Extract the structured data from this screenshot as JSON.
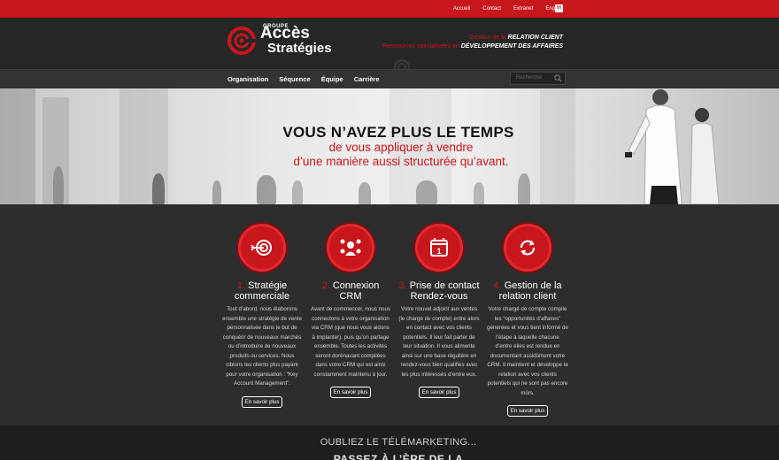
{
  "topnav": {
    "items": [
      "Accueil",
      "Contact",
      "Extranet",
      "English"
    ],
    "linkedin": "in"
  },
  "logo": {
    "line1": "GROUPE",
    "line2": "Accès",
    "line3": "Stratégies"
  },
  "tagline": {
    "line1_prefix": "Gestion de la ",
    "line1_emph": "RELATION CLIENT",
    "line2_prefix": "Ressources spécialisées en ",
    "line2_emph": "DÉVELOPPEMENT DES AFFAIRES"
  },
  "mainnav": {
    "items": [
      "Organisation",
      "Séquence",
      "Équipe",
      "Carrière"
    ]
  },
  "search": {
    "placeholder": "Recherche"
  },
  "hero": {
    "headline": "VOUS N’AVEZ PLUS LE TEMPS",
    "sub1": "de vous appliquer à vendre",
    "sub2": "d’une manière aussi structurée qu’avant."
  },
  "services": [
    {
      "num": "1.",
      "title1": "Stratégie",
      "title2": "commerciale",
      "text": "Tout d’abord, nous élaborons ensemble une stratégie de vente personnalisée dans le but de conquérir de nouveaux marchés ou d’introduire de nouveaux produits ou services. Nous ciblons les clients plus payant pour votre organisation : “Key Account Management”.",
      "button": "En savoir plus",
      "icon": "target-icon"
    },
    {
      "num": "2.",
      "title1": "Connexion",
      "title2": "CRM",
      "text": "Avant de commencer, nous nous connectons à votre organisation via CRM (que nous vous aidons à implanter), puis qu’on partage ensemble. Toutes les activités seront dorénavant compilées dans votre CRM qui est ainsi constamment maintenu à jour.",
      "button": "En savoir plus",
      "icon": "team-icon"
    },
    {
      "num": "3.",
      "title1": "Prise de contact",
      "title2": "Rendez-vous",
      "text": "Votre nouvel adjoint aux ventes (le chargé de compte) entre alors en contact avec vos clients potentiels. Il leur fait parler de leur situation. Il vous alimente ainsi sur une base régulière en rendez-vous bien qualifiés avec les plus intéressés d’entre eux.",
      "button": "En savoir plus",
      "icon": "calendar-icon",
      "calendar_day": "1"
    },
    {
      "num": "4.",
      "title1": "Gestion de la",
      "title2": "relation client",
      "text": "Votre chargé de compte compile les “opportunités d’affaires” générées et vous tient informé de l’étape à laquelle chacune d’entre elles est rendue en documentant assidûment votre CRM. Il maintient et développe la relation avec vos clients potentiels qui ne sont pas encore mûrs.",
      "button": "En savoir plus",
      "icon": "refresh-icon"
    }
  ],
  "footer_band": {
    "line1": "OUBLIEZ LE TÉLÉMARKETING...",
    "line2": "PASSEZ À L’ÈRE DE LA"
  },
  "colors": {
    "brand_red": "#c8161d",
    "dark": "#2d2d2d"
  }
}
